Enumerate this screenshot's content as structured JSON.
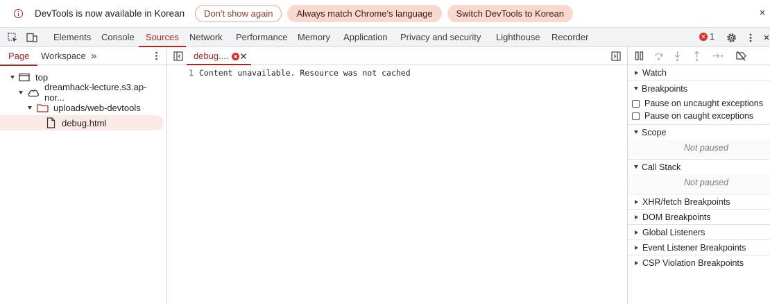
{
  "infobar": {
    "message": "DevTools is now available in Korean",
    "btn_dont_show": "Don't show again",
    "btn_match_language": "Always match Chrome's language",
    "btn_switch_korean": "Switch DevTools to Korean",
    "close": "×"
  },
  "main_tabs": [
    {
      "label": "Elements"
    },
    {
      "label": "Console"
    },
    {
      "label": "Sources",
      "active": true
    },
    {
      "label": "Network"
    },
    {
      "label": "Performance"
    },
    {
      "label": "Memory"
    },
    {
      "label": "Application"
    },
    {
      "label": "Privacy and security"
    },
    {
      "label": "Lighthouse"
    },
    {
      "label": "Recorder"
    }
  ],
  "error_count": "1",
  "navigator": {
    "tabs": [
      {
        "label": "Page",
        "active": true
      },
      {
        "label": "Workspace"
      }
    ],
    "more": "»",
    "tree": [
      {
        "label": "top",
        "icon": "frame-icon"
      },
      {
        "label": "dreamhack-lecture.s3.ap-nor...",
        "icon": "cloud-icon"
      },
      {
        "label": "uploads/web-devtools",
        "icon": "folder-icon"
      },
      {
        "label": "debug.html",
        "icon": "file-icon",
        "selected": true
      }
    ]
  },
  "editor": {
    "tab_label": "debug....",
    "line_number": "1",
    "line_text": "Content unavailable. Resource was not cached"
  },
  "debugger": {
    "watch": "Watch",
    "breakpoints": "Breakpoints",
    "pause_uncaught": "Pause on uncaught exceptions",
    "pause_caught": "Pause on caught exceptions",
    "scope": "Scope",
    "scope_status": "Not paused",
    "call_stack": "Call Stack",
    "call_stack_status": "Not paused",
    "xhr": "XHR/fetch Breakpoints",
    "dom": "DOM Breakpoints",
    "global": "Global Listeners",
    "event": "Event Listener Breakpoints",
    "csp": "CSP Violation Breakpoints"
  },
  "colors": {
    "accent": "#a8261f",
    "error": "#d93025",
    "pill_fill": "#f9d9cf"
  }
}
